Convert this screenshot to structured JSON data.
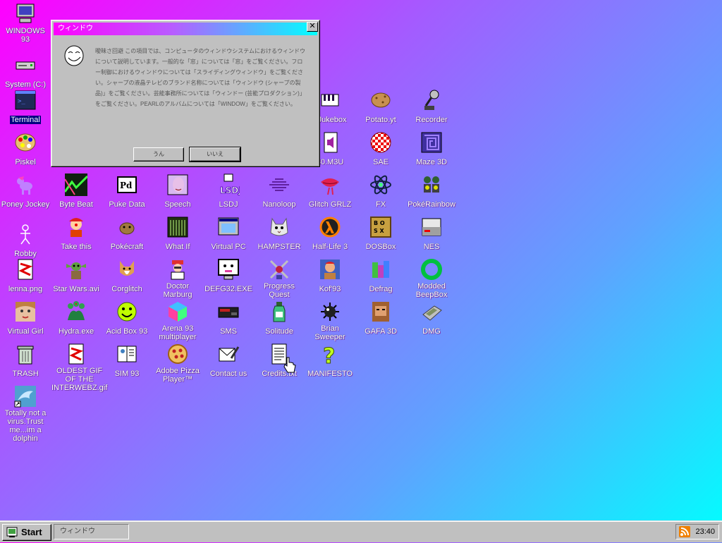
{
  "desktop_icons": [
    {
      "label": "WINDOWS 93",
      "icon": "computer-icon"
    },
    {
      "label": "System (C:)",
      "icon": "drive-icon"
    },
    {
      "label": "Terminal",
      "icon": "terminal-icon"
    },
    {
      "label": "Piskel",
      "icon": "palette-icon"
    },
    {
      "label": "Poney Jockey",
      "icon": "pony-icon"
    },
    {
      "label": "Robby",
      "icon": "stickman-icon"
    },
    {
      "label": "lenna.png",
      "icon": "image-file-icon"
    },
    {
      "label": "Virtual Girl",
      "icon": "face-icon"
    },
    {
      "label": "TRASH",
      "icon": "trash-icon"
    },
    {
      "label": "Totally not a virus.Trust me...im a dolphin",
      "icon": "dolphin-icon"
    },
    {
      "label": "Byte Beat",
      "icon": "bytebeat-icon"
    },
    {
      "label": "Take this",
      "icon": "clown-icon"
    },
    {
      "label": "Star Wars.avi",
      "icon": "yoda-icon"
    },
    {
      "label": "Hydra.exe",
      "icon": "hydra-icon"
    },
    {
      "label": "OLDEST GIF OF THE INTERWEBZ.gif",
      "icon": "image-file-icon"
    },
    {
      "label": "Puke Data",
      "icon": "pd-icon"
    },
    {
      "label": "Pokécraft",
      "icon": "rock-icon"
    },
    {
      "label": "Corglitch",
      "icon": "corgi-icon"
    },
    {
      "label": "Acid Box 93",
      "icon": "smiley-icon"
    },
    {
      "label": "SIM 93",
      "icon": "book-icon"
    },
    {
      "label": "Speech",
      "icon": "speech-face-icon"
    },
    {
      "label": "What If",
      "icon": "whatif-icon"
    },
    {
      "label": "Doctor Marburg",
      "icon": "doctor-icon"
    },
    {
      "label": "Arena 93 multiplayer",
      "icon": "cube-icon"
    },
    {
      "label": "Adobe Pizza Player™",
      "icon": "pizza-icon"
    },
    {
      "label": "LSDJ",
      "icon": "lsdj-icon"
    },
    {
      "label": "Virtual PC",
      "icon": "window-icon"
    },
    {
      "label": "DEFG32.EXE",
      "icon": "monitor-face-icon"
    },
    {
      "label": "SMS",
      "icon": "console-icon"
    },
    {
      "label": "Contact us",
      "icon": "mail-icon"
    },
    {
      "label": "Nanoloop",
      "icon": "wave-icon"
    },
    {
      "label": "HAMPSTER",
      "icon": "hamster-icon"
    },
    {
      "label": "Progress Quest",
      "icon": "swords-icon"
    },
    {
      "label": "Solitude",
      "icon": "bottle-icon"
    },
    {
      "label": "Credits.txt",
      "icon": "text-file-icon"
    },
    {
      "label": "I Jukebox",
      "icon": "piano-icon"
    },
    {
      "label": "80.M3U",
      "icon": "speaker-file-icon"
    },
    {
      "label": "Glitch GRLZ",
      "icon": "lips-icon"
    },
    {
      "label": "Half-Life 3",
      "icon": "lambda-icon"
    },
    {
      "label": "Kof'93",
      "icon": "fighter-icon"
    },
    {
      "label": "Brian Sweeper",
      "icon": "mine-icon"
    },
    {
      "label": "MANIFESTO",
      "icon": "question-icon"
    },
    {
      "label": "Potato.yt",
      "icon": "potato-icon"
    },
    {
      "label": "SAE",
      "icon": "ball-icon"
    },
    {
      "label": "FX",
      "icon": "atom-icon"
    },
    {
      "label": "DOSBox",
      "icon": "dosbox-icon"
    },
    {
      "label": "Defrag",
      "icon": "defrag-icon"
    },
    {
      "label": "GAFA 3D",
      "icon": "soldier-icon"
    },
    {
      "label": "Recorder",
      "icon": "microphone-icon"
    },
    {
      "label": "Maze 3D",
      "icon": "maze-icon"
    },
    {
      "label": "PokéRainbow",
      "icon": "trainers-icon"
    },
    {
      "label": "NES",
      "icon": "nes-icon"
    },
    {
      "label": "Modded BeepBox",
      "icon": "ring-icon"
    },
    {
      "label": "DMG",
      "icon": "gameboy-icon"
    }
  ],
  "dialog": {
    "title": "ウィンドウ",
    "close": "✕",
    "message": "曖昧さ回避 この項目では、コンピュータのウィンドウシステムにおけるウィンドウについて説明しています。一般的な「窓」については「窓」をご覧ください。フロー制御におけるウィンドウについては「スライディングウィンドウ」をご覧ください。シャープの液晶テレビのブランド名称については「ウィンドウ (シャープの製品)」をご覧ください。芸能事務所については「ウィンドー (芸能プロダクション)」をご覧ください。PEARLのアルバムについては「WINDOW」をご覧ください。",
    "buttons": {
      "ok": "うん",
      "no": "いいえ"
    }
  },
  "taskbar": {
    "start_label": "Start",
    "task_label": "ウィンドウ",
    "clock": "23:40"
  },
  "colors": {
    "accent_magenta": "#ff00ff",
    "accent_cyan": "#00ffff",
    "selection": "#000080"
  }
}
